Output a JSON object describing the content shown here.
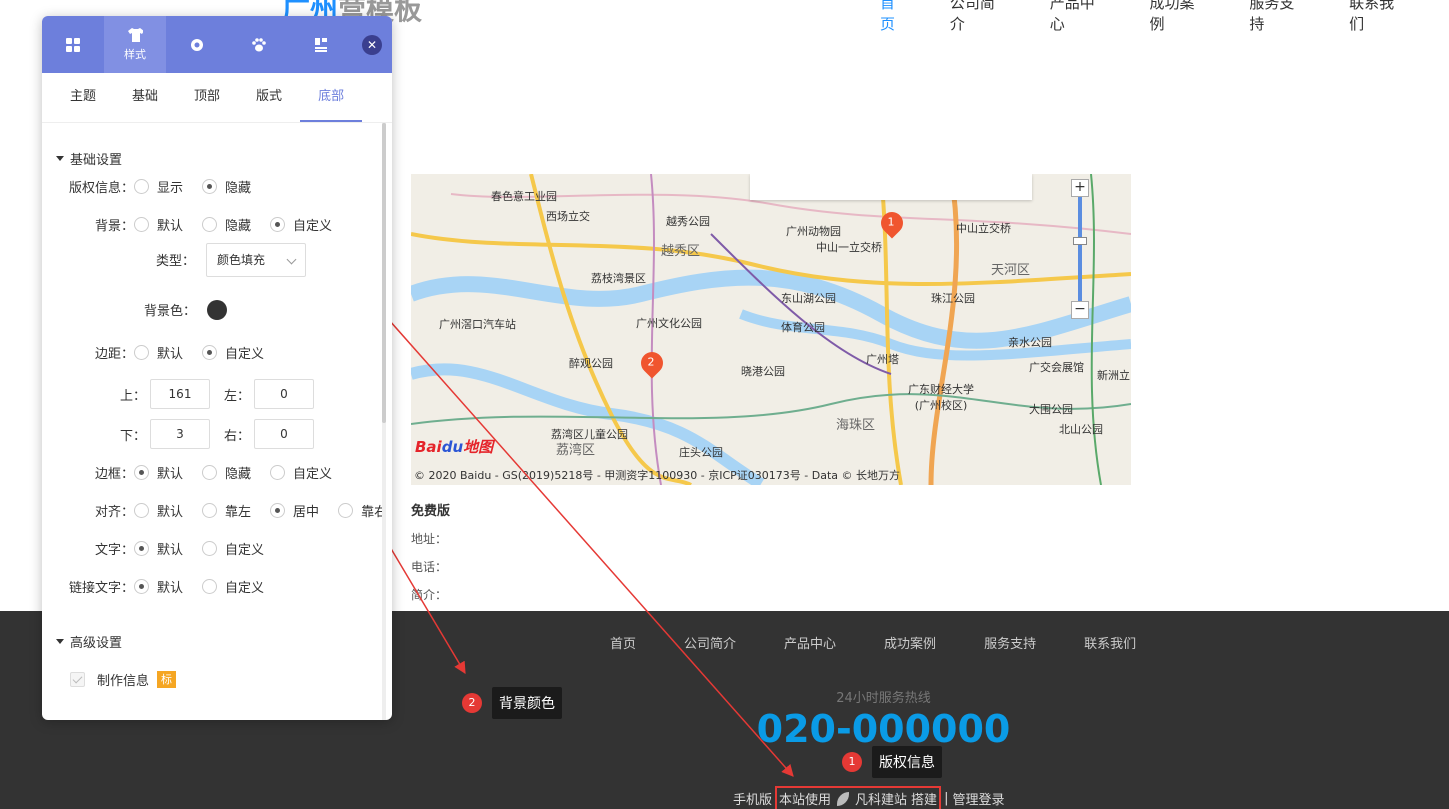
{
  "site": {
    "logo_text": "广州",
    "logo_muted": "营模板",
    "nav": [
      "首页",
      "公司简介",
      "产品中心",
      "成功案例",
      "服务支持",
      "联系我们"
    ]
  },
  "map": {
    "districts": [
      "越秀区",
      "天河区",
      "荔湾区",
      "海珠区"
    ],
    "labels": [
      "春色意工业园",
      "西场立交",
      "越秀公园",
      "广州动物园",
      "中山一立交桥",
      "中山立交桥",
      "荔枝湾景区",
      "东山湖公园",
      "珠江公园",
      "广州文化公园",
      "体育公园",
      "广州塔",
      "亲水公园",
      "醉观公园",
      "晓港公园",
      "广交会展馆",
      "新洲立",
      "广东财经大学(广州校区)",
      "大围公园",
      "荔湾区儿童公园",
      "庄头公园",
      "北山公园",
      "广州滘口汽车站"
    ],
    "marker_1": "1",
    "marker_2": "2",
    "zoom_in": "+",
    "zoom_out": "−",
    "baidu_logo": "Bai",
    "baidu_logo_paw": "du",
    "baidu_logo_suffix": "地图",
    "copyright": "© 2020 Baidu - GS(2019)5218号 - 甲测资字1100930 - 京ICP证030173号 - Data © 长地万方"
  },
  "info": {
    "title": "免费版",
    "address": "地址：",
    "phone": "电话：",
    "intro": "简介："
  },
  "footer": {
    "nav": [
      "首页",
      "公司简介",
      "产品中心",
      "成功案例",
      "服务支持",
      "联系我们"
    ],
    "hotline_label": "24小时服务热线",
    "hotline_number": "020-000000",
    "mobile": "手机版",
    "powered_prefix": "本站使用",
    "powered_brand": "凡科建站",
    "powered_suffix": "搭建",
    "separator": "|",
    "admin_login": "管理登录"
  },
  "annotations": {
    "one_num": "1",
    "one_text": "版权信息",
    "two_num": "2",
    "two_text": "背景颜色"
  },
  "panel": {
    "tabs": [
      {
        "icon": "grid-icon",
        "label": ""
      },
      {
        "icon": "shirt-icon",
        "label": "样式"
      },
      {
        "icon": "gear-icon",
        "label": ""
      },
      {
        "icon": "paw-icon",
        "label": ""
      },
      {
        "icon": "layout-icon",
        "label": ""
      }
    ],
    "close": "✕",
    "sub_tabs": [
      "主题",
      "基础",
      "顶部",
      "版式",
      "底部"
    ],
    "active_sub_tab": "底部",
    "section_basic": "基础设置",
    "copyright": {
      "key": "版权信息：",
      "options": [
        "显示",
        "隐藏"
      ],
      "selected": "隐藏"
    },
    "background": {
      "key": "背景：",
      "options": [
        "默认",
        "隐藏",
        "自定义"
      ],
      "selected": "自定义"
    },
    "type": {
      "key": "类型：",
      "value": "颜色填充"
    },
    "bg_color": {
      "key": "背景色：",
      "value": "#333333"
    },
    "margin": {
      "key": "边距：",
      "options": [
        "默认",
        "自定义"
      ],
      "selected": "自定义"
    },
    "margin_top": {
      "key": "上：",
      "value": "161"
    },
    "margin_left": {
      "key": "左：",
      "value": "0"
    },
    "margin_bottom": {
      "key": "下：",
      "value": "3"
    },
    "margin_right": {
      "key": "右：",
      "value": "0"
    },
    "border": {
      "key": "边框：",
      "options": [
        "默认",
        "隐藏",
        "自定义"
      ],
      "selected": "默认"
    },
    "align": {
      "key": "对齐：",
      "options": [
        "默认",
        "靠左",
        "居中",
        "靠右"
      ],
      "selected": "居中"
    },
    "text": {
      "key": "文字：",
      "options": [
        "默认",
        "自定义"
      ],
      "selected": "默认"
    },
    "link_text": {
      "key": "链接文字：",
      "options": [
        "默认",
        "自定义"
      ],
      "selected": "默认"
    },
    "section_advanced": "高级设置",
    "maker_info": "制作信息",
    "maker_badge": "标"
  },
  "colors": {
    "accent": "#6d7fdc",
    "footer_bg": "#333333",
    "hotline": "#0a9be6",
    "annotation_red": "#e53935"
  }
}
